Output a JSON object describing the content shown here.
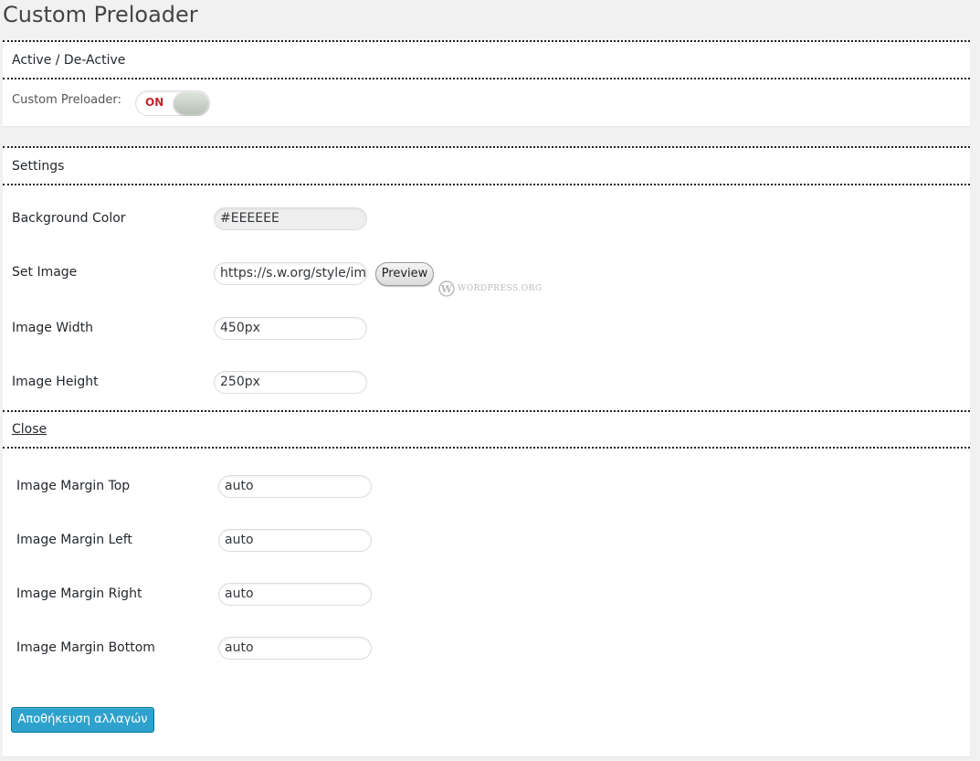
{
  "page": {
    "title": "Custom Preloader"
  },
  "activation": {
    "section_title": "Active / De-Active",
    "toggle_label": "Custom Preloader:",
    "toggle_state": "ON"
  },
  "settings": {
    "section_title": "Settings",
    "background_color": {
      "label": "Background Color",
      "value": "#EEEEEE"
    },
    "set_image": {
      "label": "Set Image",
      "value": "https://s.w.org/style/ima",
      "preview_label": "Preview"
    },
    "watermark": {
      "text": "WORDPRESS.ORG"
    },
    "image_width": {
      "label": "Image Width",
      "value": "450px"
    },
    "image_height": {
      "label": "Image Height",
      "value": "250px"
    },
    "close_label": "Close",
    "margin_top": {
      "label": "Image Margin Top",
      "value": "auto"
    },
    "margin_left": {
      "label": "Image Margin Left",
      "value": "auto"
    },
    "margin_right": {
      "label": "Image Margin Right",
      "value": "auto"
    },
    "margin_bottom": {
      "label": "Image Margin Bottom",
      "value": "auto"
    },
    "save_label": "Αποθήκευση αλλαγών"
  },
  "colors": {
    "accent": "#2ea2cc",
    "toggle_on_text": "#c0282e",
    "background_swatch": "#eeeeee"
  }
}
